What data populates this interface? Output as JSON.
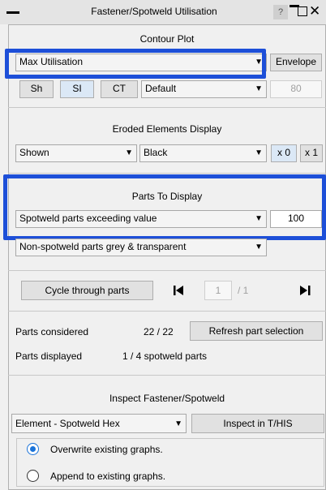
{
  "window": {
    "title": "Fastener/Spotweld Utilisation",
    "help_label": "?",
    "close_label": "✕"
  },
  "contour": {
    "heading": "Contour Plot",
    "mode_value": "Max Utilisation",
    "envelope_label": "Envelope",
    "sh_label": "Sh",
    "si_label": "SI",
    "ct_label": "CT",
    "palette_value": "Default",
    "level_value": "80"
  },
  "eroded": {
    "heading": "Eroded Elements Display",
    "display_value": "Shown",
    "color_value": "Black",
    "x0_label": "x 0",
    "x1_label": "x 1"
  },
  "parts": {
    "heading": "Parts To Display",
    "filter_value": "Spotweld parts exceeding value",
    "threshold_value": "100",
    "nonspot_value": "Non-spotweld parts grey & transparent"
  },
  "cycle": {
    "button_label": "Cycle through parts",
    "first_icon": "skip-first",
    "page_value": "1",
    "page_total": "/ 1",
    "last_icon": "skip-last"
  },
  "stats": {
    "considered_label": "Parts considered",
    "considered_value": "22 / 22",
    "refresh_label": "Refresh part selection",
    "displayed_label": "Parts displayed",
    "displayed_value": "1 / 4 spotweld parts"
  },
  "inspect": {
    "heading": "Inspect Fastener/Spotweld",
    "element_value": "Element - Spotweld Hex",
    "inspect_label": "Inspect in T/HIS",
    "overwrite_label": "Overwrite existing graphs.",
    "append_label": "Append to existing graphs.",
    "selected": "overwrite"
  },
  "colors": {
    "highlight": "#1d4fd8",
    "radio_accent": "#1a73d9",
    "hi_button": "#dbe8f6"
  }
}
